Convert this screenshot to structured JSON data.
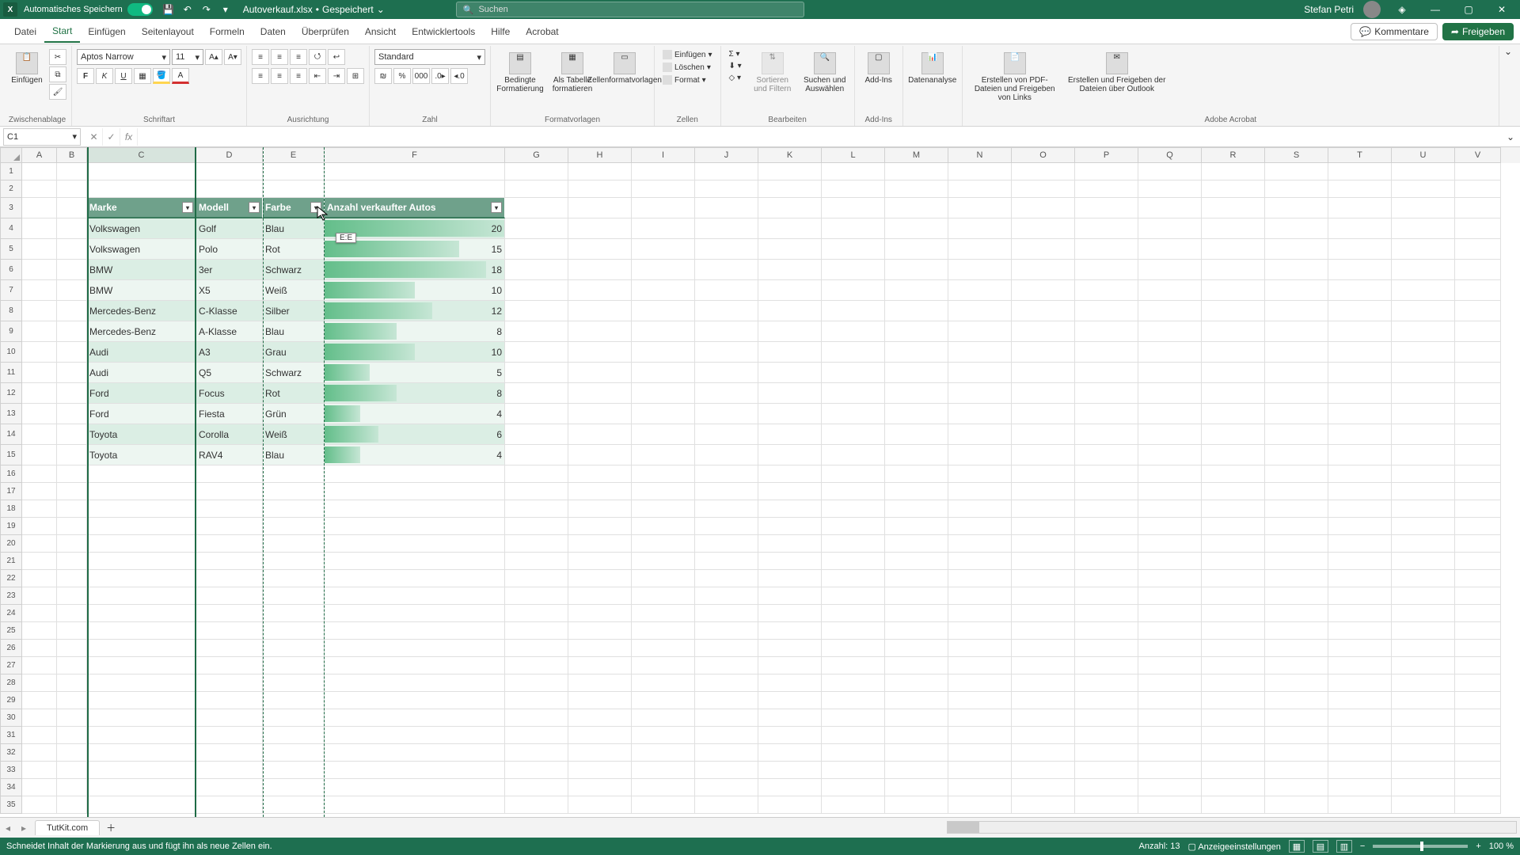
{
  "titlebar": {
    "app_icon_letter": "X",
    "autosave_label": "Automatisches Speichern",
    "filename": "Autoverkauf.xlsx",
    "saved_state": "Gespeichert",
    "search_placeholder": "Suchen",
    "user_name": "Stefan Petri"
  },
  "menu": {
    "tabs": [
      "Datei",
      "Start",
      "Einfügen",
      "Seitenlayout",
      "Formeln",
      "Daten",
      "Überprüfen",
      "Ansicht",
      "Entwicklertools",
      "Hilfe",
      "Acrobat"
    ],
    "active_tab_index": 1,
    "comments_label": "Kommentare",
    "share_label": "Freigeben"
  },
  "ribbon": {
    "clipboard": {
      "paste": "Einfügen",
      "group": "Zwischenablage"
    },
    "font": {
      "name": "Aptos Narrow",
      "size": "11",
      "group": "Schriftart"
    },
    "alignment": {
      "group": "Ausrichtung"
    },
    "number": {
      "format": "Standard",
      "group": "Zahl"
    },
    "styles": {
      "cond_fmt": "Bedingte Formatierung",
      "as_table": "Als Tabelle formatieren",
      "cell_styles": "Zellenformatvorlagen",
      "group": "Formatvorlagen"
    },
    "cells": {
      "insert": "Einfügen",
      "delete": "Löschen",
      "format": "Format",
      "group": "Zellen"
    },
    "editing": {
      "sort_filter": "Sortieren und Filtern",
      "find_select": "Suchen und Auswählen",
      "group": "Bearbeiten"
    },
    "addins": {
      "label": "Add-Ins",
      "group": "Add-Ins"
    },
    "analysis": {
      "label": "Datenanalyse"
    },
    "acrobat1": "Erstellen von PDF-Dateien und Freigeben von Links",
    "acrobat2": "Erstellen und Freigeben der Dateien über Outlook",
    "acrobat_group": "Adobe Acrobat"
  },
  "namebox": "C1",
  "columns": [
    "A",
    "B",
    "C",
    "D",
    "E",
    "F",
    "G",
    "H",
    "I",
    "J",
    "K",
    "L",
    "M",
    "N",
    "O",
    "P",
    "Q",
    "R",
    "S",
    "T",
    "U",
    "V"
  ],
  "selected_column": "C",
  "cut_column": "E",
  "table": {
    "headers": [
      "Marke",
      "Modell",
      "Farbe",
      "Anzahl verkaufter Autos"
    ],
    "rows": [
      {
        "marke": "Volkswagen",
        "modell": "Golf",
        "farbe": "Blau",
        "anzahl": 20
      },
      {
        "marke": "Volkswagen",
        "modell": "Polo",
        "farbe": "Rot",
        "anzahl": 15
      },
      {
        "marke": "BMW",
        "modell": "3er",
        "farbe": "Schwarz",
        "anzahl": 18
      },
      {
        "marke": "BMW",
        "modell": "X5",
        "farbe": "Weiß",
        "anzahl": 10
      },
      {
        "marke": "Mercedes-Benz",
        "modell": "C-Klasse",
        "farbe": "Silber",
        "anzahl": 12
      },
      {
        "marke": "Mercedes-Benz",
        "modell": "A-Klasse",
        "farbe": "Blau",
        "anzahl": 8
      },
      {
        "marke": "Audi",
        "modell": "A3",
        "farbe": "Grau",
        "anzahl": 10
      },
      {
        "marke": "Audi",
        "modell": "Q5",
        "farbe": "Schwarz",
        "anzahl": 5
      },
      {
        "marke": "Ford",
        "modell": "Focus",
        "farbe": "Rot",
        "anzahl": 8
      },
      {
        "marke": "Ford",
        "modell": "Fiesta",
        "farbe": "Grün",
        "anzahl": 4
      },
      {
        "marke": "Toyota",
        "modell": "Corolla",
        "farbe": "Weiß",
        "anzahl": 6
      },
      {
        "marke": "Toyota",
        "modell": "RAV4",
        "farbe": "Blau",
        "anzahl": 4
      }
    ],
    "max_anzahl": 20
  },
  "drop_badge": "E:E",
  "sheet_tab": "TutKit.com",
  "status": {
    "message": "Schneidet Inhalt der Markierung aus und fügt ihn als neue Zellen ein.",
    "count_label": "Anzahl: 13",
    "disp_settings": "Anzeigeeinstellungen",
    "zoom": "100 %"
  }
}
